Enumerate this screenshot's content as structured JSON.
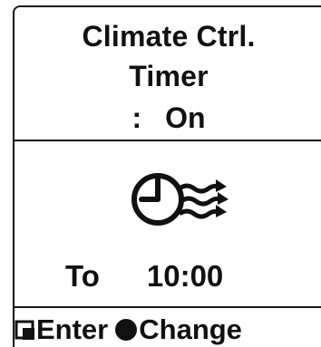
{
  "title": {
    "line1": "Climate Ctrl.",
    "line2": "Timer"
  },
  "status": {
    "separator": ":",
    "value": "On"
  },
  "icon": {
    "name": "clock-airflow-icon"
  },
  "schedule": {
    "to_label": "To",
    "time": "10:00"
  },
  "footer": {
    "enter_icon": "enter-key-icon",
    "enter_label": "Enter",
    "change_icon": "filled-circle-icon",
    "change_label": "Change"
  },
  "colors": {
    "foreground": "#111111",
    "background": "#ffffff"
  }
}
